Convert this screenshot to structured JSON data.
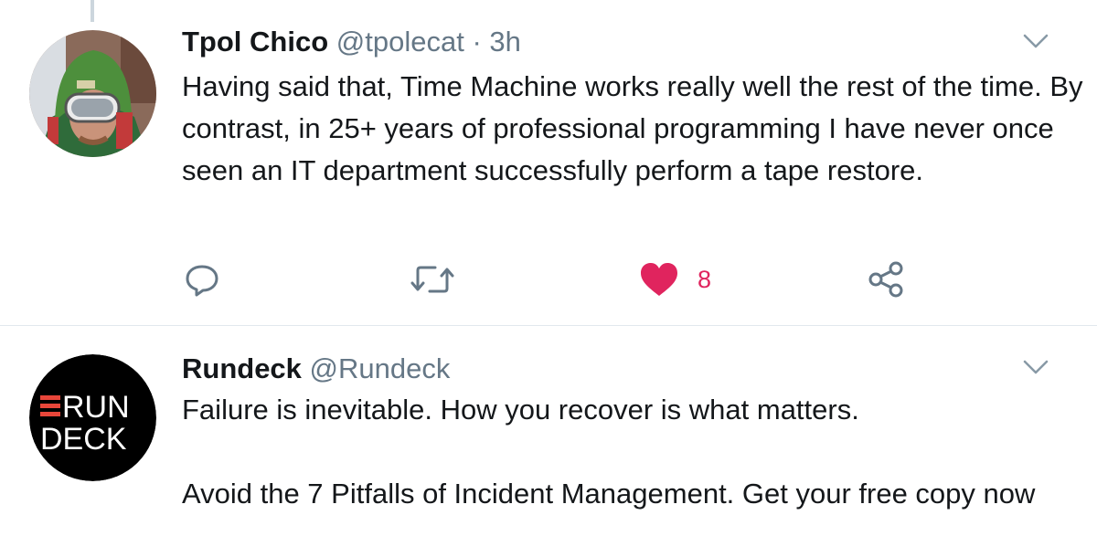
{
  "tweets": [
    {
      "name": "Tpol Chico",
      "handle": "@tpolecat",
      "separator": " · ",
      "time": "3h",
      "avatar_icon": "avatar-photo",
      "text": "Having said that, Time Machine works really well the rest of the time. By contrast, in 25+ years of professional programming I have never once seen an IT department successfully perform a tape restore.",
      "actions": {
        "reply_icon": "reply-icon",
        "retweet_icon": "retweet-icon",
        "like_icon": "heart-icon",
        "like_count": "8",
        "share_icon": "share-icon"
      }
    },
    {
      "name": "Rundeck",
      "handle": "@Rundeck",
      "avatar_icon": "rundeck-logo",
      "avatar_text_line1": "RUN",
      "avatar_text_line2": "DECK",
      "text": "Failure is inevitable. How you recover is what matters.\n\nAvoid the 7 Pitfalls of Incident Management. Get your free copy now"
    }
  ],
  "colors": {
    "text_primary": "#14171a",
    "text_secondary": "#657786",
    "icon_gray": "#657786",
    "like_active": "#e0245e",
    "divider": "#e1e8ed",
    "logo_red": "#e8463a"
  }
}
